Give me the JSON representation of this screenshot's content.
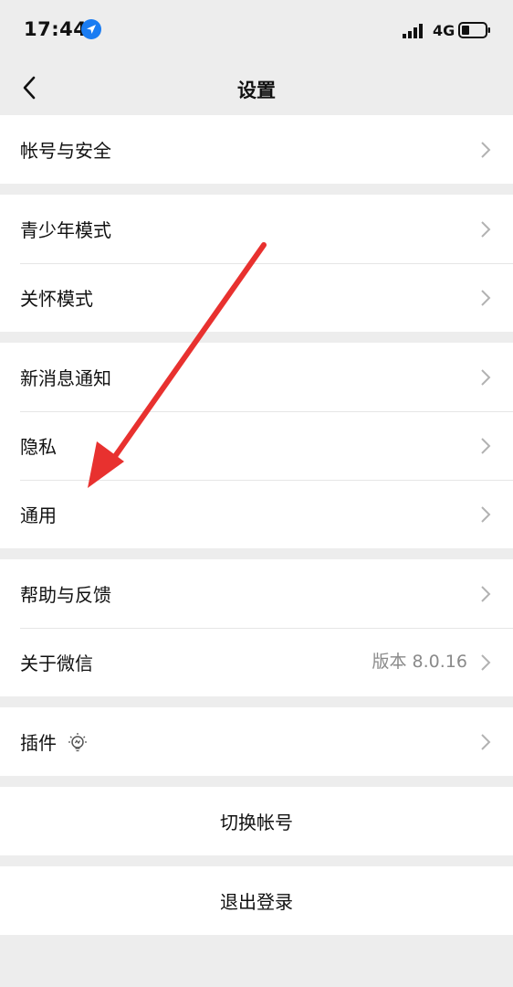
{
  "status_bar": {
    "time": "17:44",
    "network": "4G"
  },
  "nav": {
    "title": "设置"
  },
  "groups": [
    {
      "items": [
        {
          "label": "帐号与安全"
        }
      ]
    },
    {
      "items": [
        {
          "label": "青少年模式"
        },
        {
          "label": "关怀模式"
        }
      ]
    },
    {
      "items": [
        {
          "label": "新消息通知"
        },
        {
          "label": "隐私"
        },
        {
          "label": "通用"
        }
      ]
    },
    {
      "items": [
        {
          "label": "帮助与反馈"
        },
        {
          "label": "关于微信",
          "value": "版本 8.0.16"
        }
      ]
    },
    {
      "items": [
        {
          "label": "插件"
        }
      ]
    }
  ],
  "actions": {
    "switch_account": "切换帐号",
    "logout": "退出登录"
  },
  "colors": {
    "background": "#ededed",
    "annotation_arrow": "#e8312f",
    "location_blue": "#1a7cf2"
  }
}
